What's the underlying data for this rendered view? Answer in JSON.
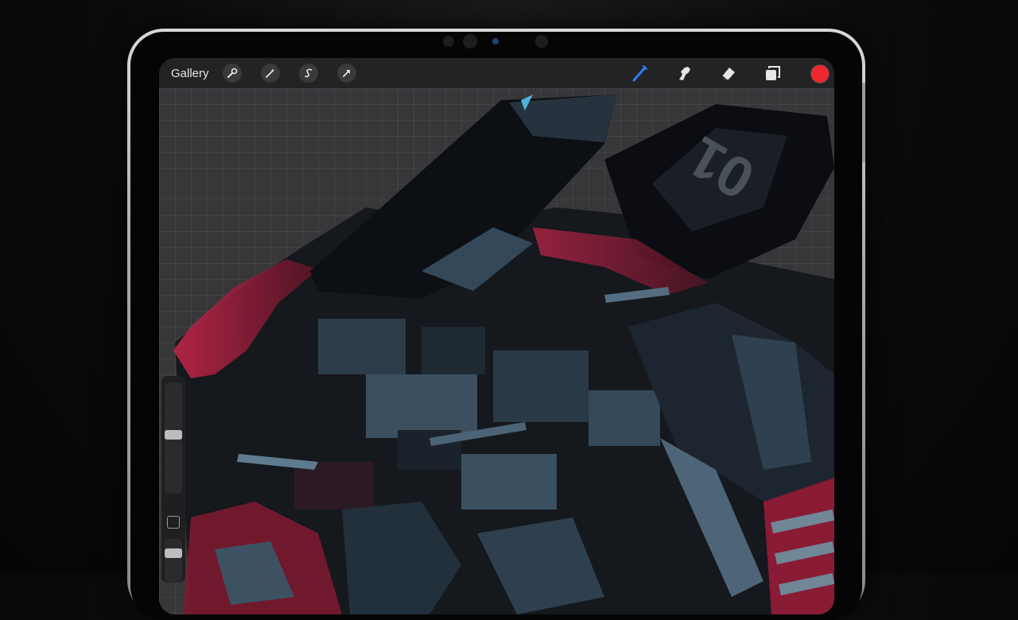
{
  "toolbar": {
    "gallery_label": "Gallery",
    "left_tools": [
      {
        "name": "actions",
        "icon": "wrench-icon"
      },
      {
        "name": "adjustments",
        "icon": "magic-wand-icon"
      },
      {
        "name": "selection",
        "icon": "selection-s-icon"
      },
      {
        "name": "transform",
        "icon": "arrow-cursor-icon"
      }
    ],
    "right_tools": [
      {
        "name": "brush",
        "icon": "brush-icon",
        "active": true
      },
      {
        "name": "smudge",
        "icon": "smudge-finger-icon"
      },
      {
        "name": "eraser",
        "icon": "eraser-icon"
      },
      {
        "name": "layers",
        "icon": "layers-icon"
      }
    ],
    "active_color": "#f0272f",
    "accent_color": "#2f7cf6"
  },
  "sidebar": {
    "brush_size": 0.48,
    "opacity": 1.0,
    "modify_button_icon": "square-icon"
  },
  "artwork": {
    "decal_text": "01"
  }
}
